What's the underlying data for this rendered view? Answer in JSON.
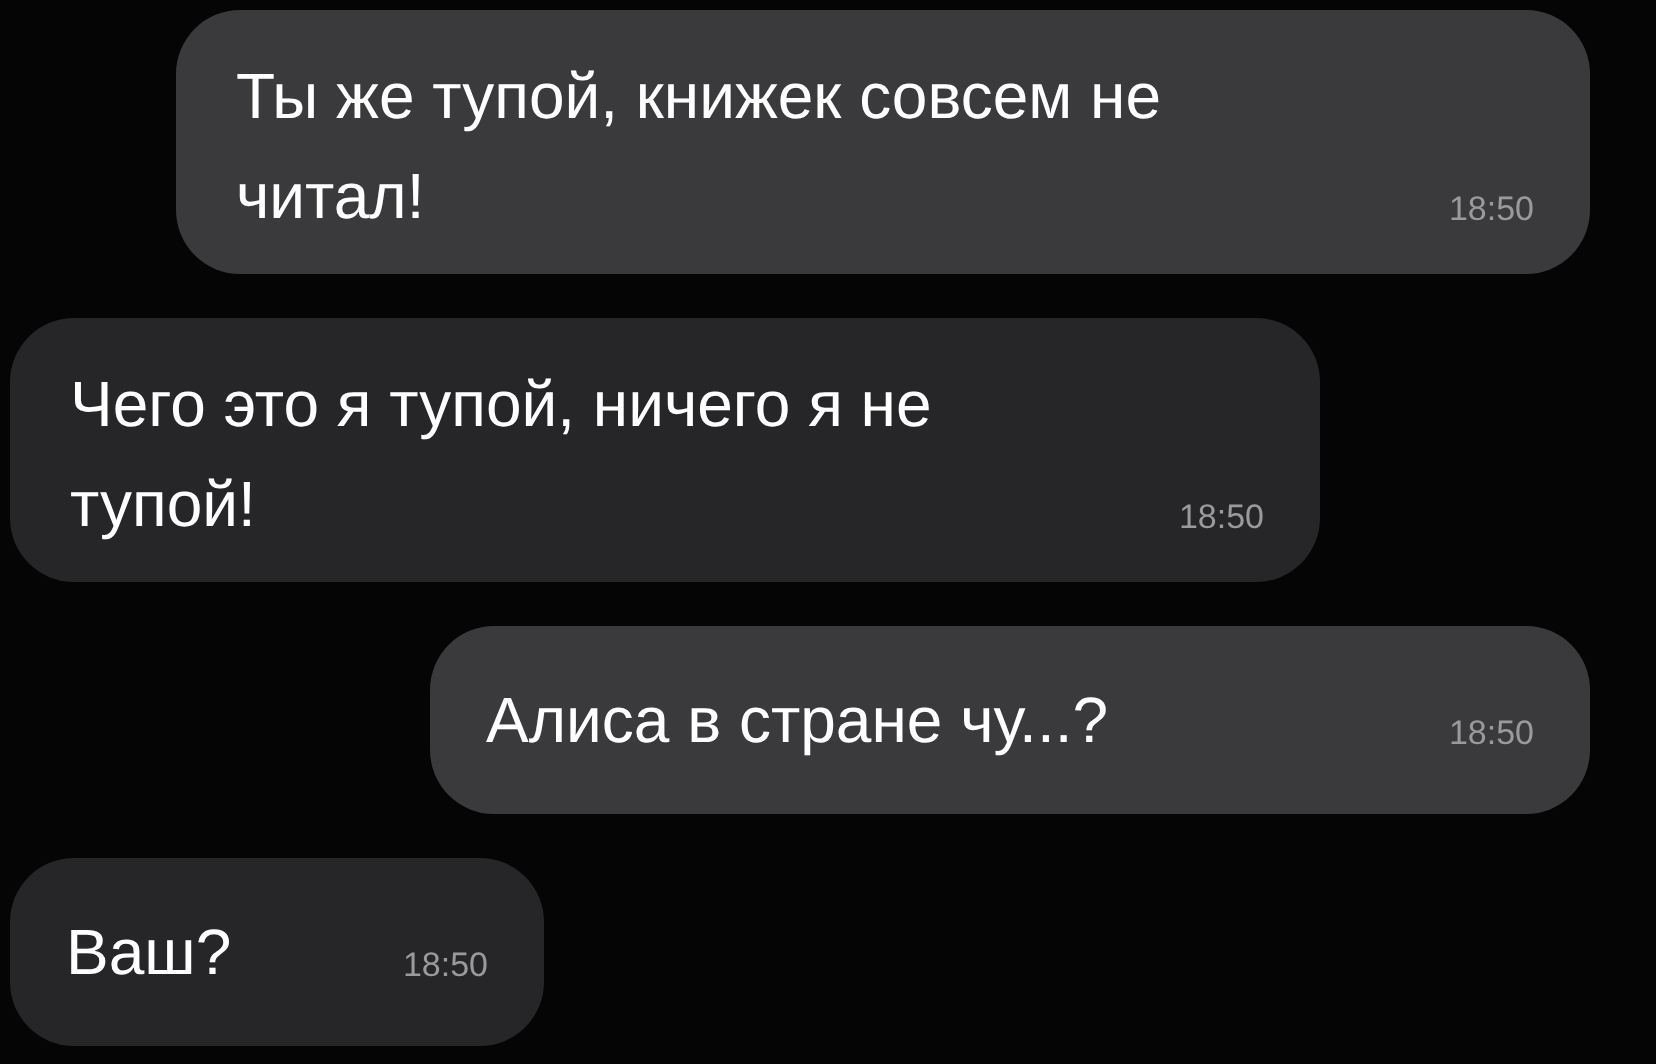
{
  "messages": [
    {
      "text": "Ты же тупой, книжек совсем не читал!",
      "time": "18:50",
      "outgoing": true
    },
    {
      "text": "Чего это я тупой, ничего я не тупой!",
      "time": "18:50",
      "outgoing": false
    },
    {
      "text": "Алиса в стране чу...?",
      "time": "18:50",
      "outgoing": true
    },
    {
      "text": "Ваш?",
      "time": "18:50",
      "outgoing": false
    }
  ]
}
